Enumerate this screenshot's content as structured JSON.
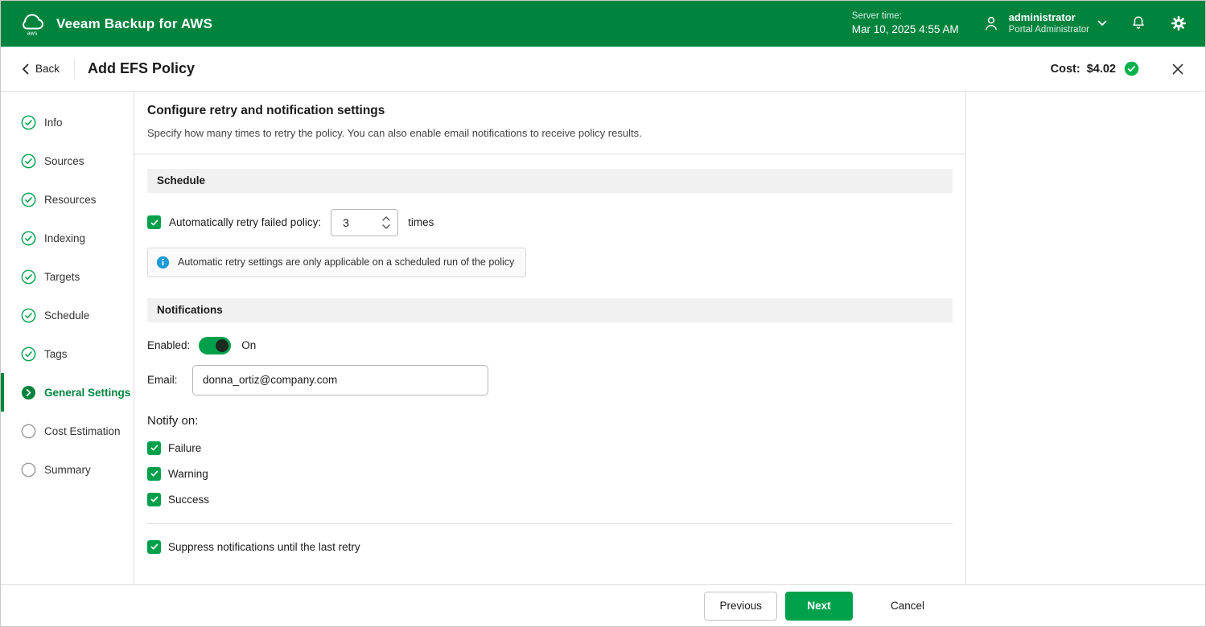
{
  "header": {
    "app_title": "Veeam Backup for AWS",
    "server_time_label": "Server time:",
    "server_time_value": "Mar 10, 2025 4:55 AM",
    "user_name": "administrator",
    "user_role": "Portal Administrator"
  },
  "toolbar": {
    "back_label": "Back",
    "page_title": "Add EFS Policy",
    "cost_label": "Cost:",
    "cost_value": "$4.02"
  },
  "wizard": {
    "steps": [
      {
        "label": "Info",
        "state": "done"
      },
      {
        "label": "Sources",
        "state": "done"
      },
      {
        "label": "Resources",
        "state": "done"
      },
      {
        "label": "Indexing",
        "state": "done"
      },
      {
        "label": "Targets",
        "state": "done"
      },
      {
        "label": "Schedule",
        "state": "done"
      },
      {
        "label": "Tags",
        "state": "done"
      },
      {
        "label": "General Settings",
        "state": "current"
      },
      {
        "label": "Cost Estimation",
        "state": "todo"
      },
      {
        "label": "Summary",
        "state": "todo"
      }
    ]
  },
  "content": {
    "title": "Configure retry and notification settings",
    "subtitle": "Specify how many times to retry the policy. You can also enable email notifications to receive policy results.",
    "schedule": {
      "header": "Schedule",
      "retry_label": "Automatically retry failed policy:",
      "retry_value": "3",
      "retry_suffix": "times",
      "info_text": "Automatic retry settings are only applicable on a scheduled run of the policy"
    },
    "notifications": {
      "header": "Notifications",
      "enabled_label": "Enabled:",
      "enabled_state": "On",
      "email_label": "Email:",
      "email_value": "donna_ortiz@company.com",
      "notify_on_label": "Notify on:",
      "options": [
        {
          "label": "Failure",
          "checked": true
        },
        {
          "label": "Warning",
          "checked": true
        },
        {
          "label": "Success",
          "checked": true
        }
      ],
      "suppress_label": "Suppress notifications until the last retry"
    }
  },
  "footer": {
    "previous_label": "Previous",
    "next_label": "Next",
    "cancel_label": "Cancel"
  },
  "colors": {
    "header_green": "#00843D",
    "accent_green": "#00A04A",
    "next_button_green": "#00A14B",
    "badge_green": "#00B14C",
    "info_blue": "#1E9BD7"
  }
}
